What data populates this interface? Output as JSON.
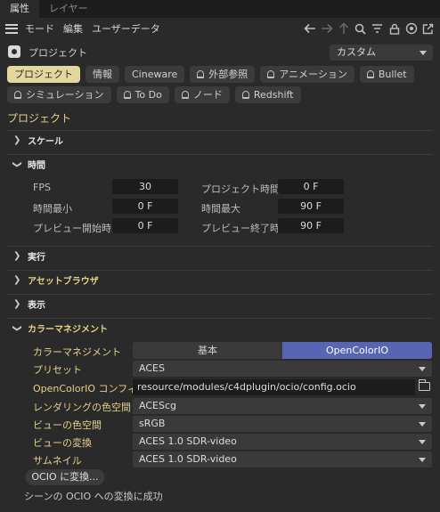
{
  "tabs": [
    {
      "label": "属性"
    },
    {
      "label": "レイヤー"
    }
  ],
  "menu": {
    "items": [
      "モード",
      "編集",
      "ユーザーデータ"
    ]
  },
  "toolbar": {
    "icons": [
      "arrow-left-icon",
      "arrow-right-icon",
      "arrow-up-icon",
      "search-icon",
      "filter-icon",
      "lock-icon",
      "target-icon",
      "new-window-icon"
    ]
  },
  "object": {
    "name": "プロジェクト",
    "mode_select": "カスタム"
  },
  "categories": {
    "row1": [
      "プロジェクト",
      "情報",
      "Cineware",
      "外部参照",
      "アニメーション",
      "Bullet"
    ],
    "row2": [
      "シミュレーション",
      "To Do",
      "ノード",
      "Redshift"
    ],
    "active": "プロジェクト"
  },
  "section_title": "プロジェクト",
  "groups": {
    "scale": "スケール",
    "time": "時間",
    "execute": "実行",
    "asset_browser": "アセットブラウザ",
    "display": "表示",
    "color_management": "カラーマネジメント"
  },
  "time": {
    "fps_label": "FPS",
    "fps_value": "30",
    "project_time_label": "プロジェクト時間",
    "project_time_value": "0 F",
    "min_time_label": "時間最小",
    "min_time_value": "0 F",
    "max_time_label": "時間最大",
    "max_time_value": "90 F",
    "preview_start_label": "プレビュー開始時間",
    "preview_start_value": "0 F",
    "preview_end_label": "プレビュー終了時間",
    "preview_end_value": "90 F"
  },
  "color_mgmt": {
    "mode_label": "カラーマネジメント",
    "mode_basic": "基本",
    "mode_ocio": "OpenColorIO",
    "mode_selected": "OpenColorIO",
    "preset_label": "プリセット",
    "preset_value": "ACES",
    "config_label": "OpenColorIO コンフィグ",
    "config_value": "resource/modules/c4dplugin/ocio/config.ocio",
    "render_space_label": "レンダリングの色空間",
    "render_space_value": "ACEScg",
    "view_space_label": "ビューの色空間",
    "view_space_value": "sRGB",
    "view_transform_label": "ビューの変換",
    "view_transform_value": "ACES 1.0 SDR-video",
    "thumbnail_label": "サムネイル",
    "thumbnail_value": "ACES 1.0 SDR-video",
    "convert_button": "OCIO に変換...",
    "status_text": "シーンの OCIO への変換に成功"
  },
  "colors": {
    "accent_yellow": "#e3d28a",
    "active_tab": "#e4d79e",
    "ocio_selected": "#5765b4"
  }
}
